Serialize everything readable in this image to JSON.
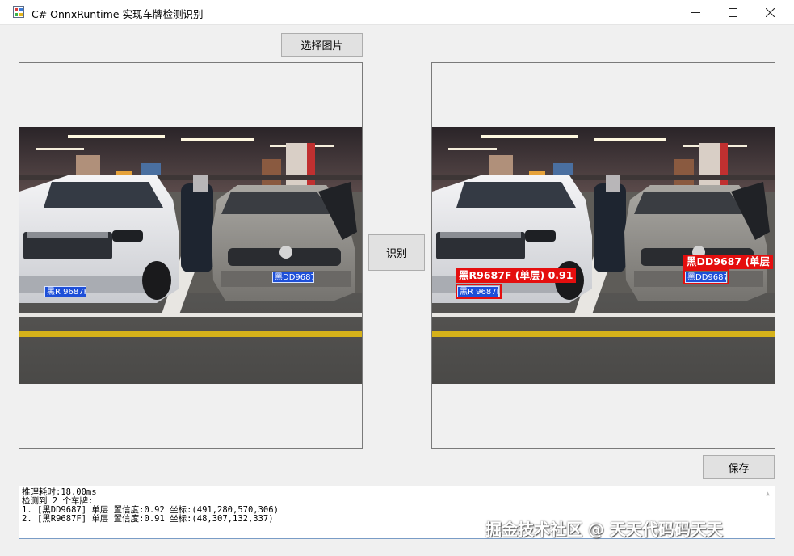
{
  "window": {
    "title": "C# OnnxRuntime  实现车牌检测识别",
    "icon": "app-form-icon",
    "controls": [
      "minimize-icon",
      "maximize-icon",
      "close-icon"
    ]
  },
  "buttons": {
    "select_image": "选择图片",
    "detect": "识别",
    "save": "保存"
  },
  "source_image": {
    "plates": [
      "黑R 9687F",
      "黑DD9687"
    ]
  },
  "result_image": {
    "plates": [
      "黑R 9687F",
      "黑DD9687"
    ],
    "labels": [
      "黑R9687F (单层) 0.91",
      "黑DD9687 (单层"
    ]
  },
  "log": {
    "lines": [
      "推理耗时:18.00ms",
      "检测到 2 个车牌:",
      "1. [黑DD9687] 单层 置信度:0.92 坐标:(491,280,570,306)",
      "2. [黑R9687F] 单层 置信度:0.91 坐标:(48,307,132,337)"
    ]
  },
  "watermark": "掘金技术社区 @ 天天代码码天天",
  "colors": {
    "box": "#e40e0e",
    "plate": "#1d4fd8",
    "window_bg": "#f0f0f0"
  }
}
